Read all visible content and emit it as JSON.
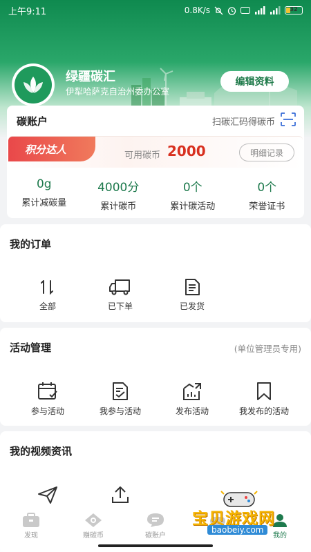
{
  "status_bar": {
    "time": "上午9:11",
    "speed": "0.8K/s",
    "battery": "32",
    "battery_level_percent": 32
  },
  "profile": {
    "name": "绿疆碳汇",
    "org": "伊犁哈萨克自治州委办公室",
    "edit_label": "编辑资料"
  },
  "carbon_account": {
    "title": "碳账户",
    "scan_label": "扫碳汇码得碳币",
    "badge": "积分达人",
    "coin_label": "可用碳币",
    "coin_value": "2000",
    "detail_label": "明细记录",
    "stats": [
      {
        "value": "0g",
        "label": "累计减碳量"
      },
      {
        "value": "4000分",
        "label": "累计碳币"
      },
      {
        "value": "0个",
        "label": "累计碳活动"
      },
      {
        "value": "0个",
        "label": "荣誉证书"
      }
    ]
  },
  "orders": {
    "title": "我的订单",
    "items": [
      {
        "label": "全部",
        "icon": "sort-icon"
      },
      {
        "label": "已下单",
        "icon": "truck-icon"
      },
      {
        "label": "已发货",
        "icon": "document-icon"
      }
    ]
  },
  "activity": {
    "title": "活动管理",
    "note": "(单位管理员专用)",
    "items": [
      {
        "label": "参与活动",
        "icon": "calendar-check-icon"
      },
      {
        "label": "我参与活动",
        "icon": "clipboard-check-icon"
      },
      {
        "label": "发布活动",
        "icon": "chart-publish-icon"
      },
      {
        "label": "我发布的活动",
        "icon": "bookmark-icon"
      }
    ]
  },
  "videos": {
    "title": "我的视频资讯",
    "items": [
      {
        "icon": "send-icon"
      },
      {
        "icon": "upload-icon"
      }
    ]
  },
  "bottom_nav": [
    {
      "label": "发现",
      "icon": "briefcase-icon",
      "active": false
    },
    {
      "label": "赚碳币",
      "icon": "eye-icon",
      "active": false
    },
    {
      "label": "碳账户",
      "icon": "chat-icon",
      "active": false
    },
    {
      "label": "",
      "icon": "gamepad-icon",
      "active": false
    },
    {
      "label": "我的",
      "icon": "user-icon",
      "active": true
    }
  ],
  "watermark": {
    "text": "宝贝游戏网",
    "url": "baobeiy.com"
  },
  "colors": {
    "brand_green": "#1e7a4d",
    "accent_red": "#d8301f"
  }
}
